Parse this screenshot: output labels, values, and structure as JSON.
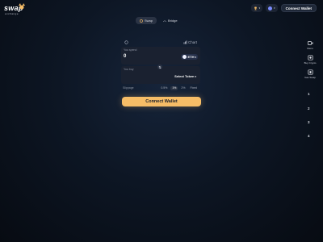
{
  "header": {
    "logo_text": "swap",
    "logo_sub": "exchange",
    "tabs": [
      {
        "label": "Swap",
        "icon": "swap-icon",
        "active": true
      },
      {
        "label": "Bridge",
        "icon": "bridge-icon",
        "active": false
      }
    ],
    "connect_label": "Connect Wallet"
  },
  "swap_card": {
    "chart_label": "Chart",
    "pay": {
      "label": "You spend",
      "amount": "0",
      "token": "ETH"
    },
    "receive": {
      "label": "You buy",
      "token_placeholder": "Select Token"
    },
    "slippage": {
      "label": "Slippage",
      "options": [
        "0.5%",
        "1%",
        "2%",
        "Fixed"
      ],
      "selected": "1%"
    },
    "connect_label": "Connect Wallet"
  },
  "right_rail": {
    "items": [
      {
        "label": "Menu",
        "icon": "video-icon"
      },
      {
        "label": "Buy Crypto",
        "icon": "buy-crypto-icon"
      },
      {
        "label": "Gas Swap",
        "icon": "gas-icon"
      }
    ],
    "numbers": [
      "1",
      "2",
      "3",
      "4"
    ]
  },
  "colors": {
    "accent": "#f6bd67",
    "background": "#0d1624",
    "panel": "#1a2130"
  }
}
